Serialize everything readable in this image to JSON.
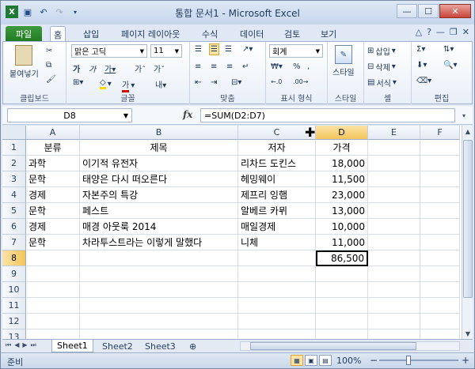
{
  "window": {
    "title": "통합 문서1  -  Microsoft Excel"
  },
  "tabs": [
    "파일",
    "홈",
    "삽입",
    "페이지 레이아웃",
    "수식",
    "데이터",
    "검토",
    "보기"
  ],
  "active_tab": "홈",
  "ribbon": {
    "clipboard": {
      "label": "클립보드",
      "paste": "붙여넣기"
    },
    "font": {
      "label": "글꼴",
      "name": "맑은 고딕",
      "size": "11"
    },
    "alignment": {
      "label": "맞춤"
    },
    "number": {
      "label": "표시 형식",
      "format": "회계"
    },
    "styles": {
      "label": "스타일",
      "button": "스타일"
    },
    "cells": {
      "label": "셀",
      "insert": "삽입",
      "delete": "삭제",
      "format": "서식"
    },
    "editing": {
      "label": "편집"
    }
  },
  "formula_bar": {
    "name_box": "D8",
    "fx": "fx",
    "formula": "=SUM(D2:D7)"
  },
  "columns": [
    "A",
    "B",
    "C",
    "D",
    "E",
    "F"
  ],
  "rows": [
    "1",
    "2",
    "3",
    "4",
    "5",
    "6",
    "7",
    "8",
    "9",
    "10",
    "11",
    "12",
    "13"
  ],
  "selected": {
    "column": "D",
    "row": "8"
  },
  "table": [
    [
      "분류",
      "제목",
      "저자",
      "가격"
    ],
    [
      "과학",
      "이기적 유전자",
      "리차드 도킨스",
      "18,000"
    ],
    [
      "문학",
      "태양은 다시 떠오른다",
      "헤밍웨이",
      "11,500"
    ],
    [
      "경제",
      "자본주의 특강",
      "제프리 잉햄",
      "23,000"
    ],
    [
      "문학",
      "페스트",
      "알베르 카뮈",
      "13,000"
    ],
    [
      "경제",
      "매경 아웃룩 2014",
      "매일경제",
      "10,000"
    ],
    [
      "문학",
      "차라투스트라는 이렇게 말했다",
      "니체",
      "11,000"
    ],
    [
      "",
      "",
      "",
      "86,500"
    ]
  ],
  "sheets": [
    "Sheet1",
    "Sheet2",
    "Sheet3"
  ],
  "active_sheet": "Sheet1",
  "status": {
    "ready": "준비",
    "zoom": "100%",
    "minus": "−",
    "plus": "+"
  }
}
